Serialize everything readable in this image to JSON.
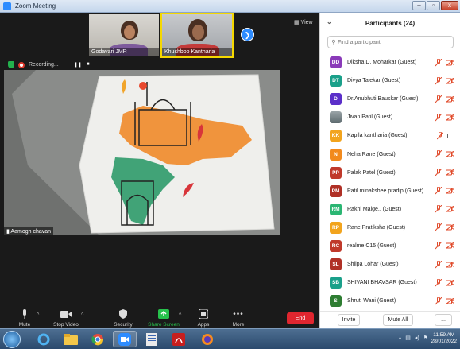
{
  "window": {
    "title": "Zoom Meeting",
    "buttons": [
      "–",
      "▫",
      "x"
    ]
  },
  "thumbnails": [
    {
      "name": "Godavari JMR",
      "active": false
    },
    {
      "name": "Khushboo Kantharia",
      "active": true
    }
  ],
  "view_label": "View",
  "recording": {
    "label": "Recording...",
    "pause": "❚❚",
    "stop": "■"
  },
  "main_video": {
    "speaker": "Aamogh chavan"
  },
  "toolbar": {
    "mute": "Mute",
    "stop_video": "Stop Video",
    "security": "Security",
    "share_screen": "Share Screen",
    "apps": "Apps",
    "more": "More",
    "end": "End"
  },
  "participants": {
    "title": "Participants (24)",
    "search_placeholder": "Find a participant",
    "list": [
      {
        "initials": "DD",
        "color": "#8a3ab9",
        "name": "Diksha D. Moharkar (Guest)",
        "video": "off"
      },
      {
        "initials": "DT",
        "color": "#1aa08a",
        "name": "Divya Talekar (Guest)",
        "video": "off"
      },
      {
        "initials": "D",
        "color": "#5b2fc9",
        "name": "Dr.Anubhuti Bauskar (Guest)",
        "video": "off"
      },
      {
        "initials": "",
        "color": "photo",
        "name": "Jivan Patil (Guest)",
        "video": "off"
      },
      {
        "initials": "KK",
        "color": "#f2a41d",
        "name": "Kapila kantharia (Guest)",
        "video": "on"
      },
      {
        "initials": "N",
        "color": "#f28a1d",
        "name": "Neha Rane (Guest)",
        "video": "off"
      },
      {
        "initials": "PP",
        "color": "#c0392b",
        "name": "Palak Patel (Guest)",
        "video": "off"
      },
      {
        "initials": "PM",
        "color": "#b03026",
        "name": "Patil minakshee pradip (Guest)",
        "video": "off"
      },
      {
        "initials": "RM",
        "color": "#2bb673",
        "name": "Rakhi Malge.. (Guest)",
        "video": "off"
      },
      {
        "initials": "RP",
        "color": "#f2a41d",
        "name": "Rane Pratiksha (Guest)",
        "video": "off"
      },
      {
        "initials": "RC",
        "color": "#c0392b",
        "name": "realme C15 (Guest)",
        "video": "off"
      },
      {
        "initials": "SL",
        "color": "#b03026",
        "name": "Shilpa Lohar (Guest)",
        "video": "off"
      },
      {
        "initials": "SB",
        "color": "#1aa08a",
        "name": "SHIVANI BHAVSAR (Guest)",
        "video": "off"
      },
      {
        "initials": "S",
        "color": "#2e7d32",
        "name": "Shruti Wani (Guest)",
        "video": "off"
      }
    ],
    "footer": {
      "invite": "Invite",
      "mute_all": "Mute All",
      "more": "..."
    }
  },
  "taskbar": {
    "time": "11:59 AM",
    "date": "28/01/2022"
  }
}
